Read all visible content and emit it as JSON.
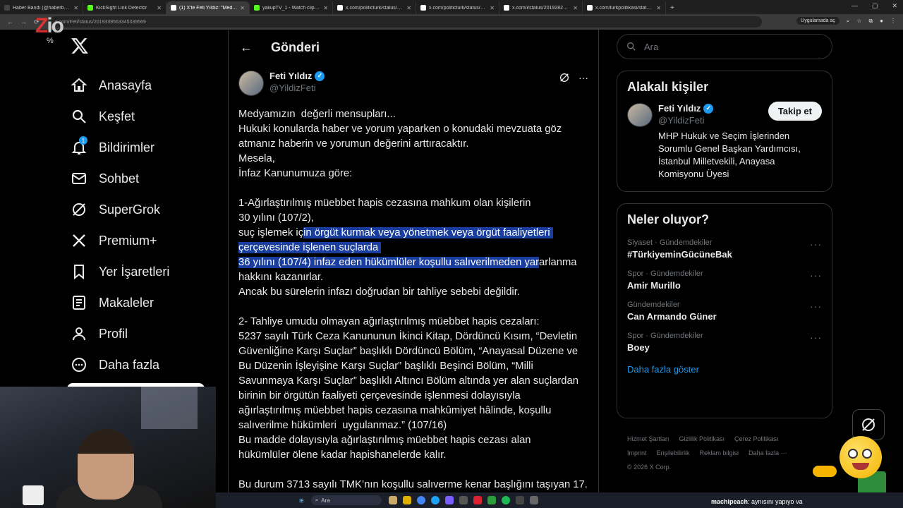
{
  "browser": {
    "tabs": [
      {
        "title": "Haber Bandı (@haberbandicom)",
        "color": "#444",
        "active": false
      },
      {
        "title": "KickSight Link Detector",
        "color": "#53fc18",
        "active": false
      },
      {
        "title": "(1) X'te Feti Yıldız: \"Medyamızın...",
        "color": "#fff",
        "active": true
      },
      {
        "title": "yakupTV_1 - Watch clips on Ki...",
        "color": "#53fc18",
        "active": false
      },
      {
        "title": "x.com/politicturk/status/20193...",
        "color": "#fff",
        "active": false
      },
      {
        "title": "x.com/politicturk/status/20193...",
        "color": "#fff",
        "active": false
      },
      {
        "title": "x.com/i/status/2019282412522...",
        "color": "#fff",
        "active": false
      },
      {
        "title": "x.com/turkpolitikasi/status/124...",
        "color": "#fff",
        "active": false
      }
    ],
    "url": "x.com/Feti/status/2019339563345339569",
    "app_badge": "Uygulamada aç"
  },
  "watermark": {
    "logo": "ZIO",
    "sub": "%"
  },
  "nav": {
    "items": [
      {
        "label": "Anasayfa",
        "icon": "home-icon"
      },
      {
        "label": "Keşfet",
        "icon": "search-icon"
      },
      {
        "label": "Bildirimler",
        "icon": "bell-icon",
        "badge": "1"
      },
      {
        "label": "Sohbet",
        "icon": "mail-icon"
      },
      {
        "label": "SuperGrok",
        "icon": "grok-icon"
      },
      {
        "label": "Premium+",
        "icon": "x-icon"
      },
      {
        "label": "Yer İşaretleri",
        "icon": "bookmark-icon"
      },
      {
        "label": "Makaleler",
        "icon": "article-icon"
      },
      {
        "label": "Profil",
        "icon": "person-icon"
      },
      {
        "label": "Daha fazla",
        "icon": "more-icon"
      }
    ]
  },
  "main": {
    "header_title": "Gönderi",
    "author": {
      "name": "Feti Yıldız",
      "handle": "@YildizFeti"
    },
    "tweet_lines": [
      {
        "segments": [
          {
            "t": "Medyamızın  değerli mensupları...",
            "h": false
          }
        ]
      },
      {
        "segments": [
          {
            "t": "Hukuki konularda haber ve yorum yaparken o konudaki mevzuata göz",
            "h": false
          }
        ]
      },
      {
        "segments": [
          {
            "t": "atmanız haberin ve yorumun değerini arttıracaktır.",
            "h": false
          }
        ]
      },
      {
        "segments": [
          {
            "t": "Mesela,",
            "h": false
          }
        ]
      },
      {
        "segments": [
          {
            "t": "İnfaz Kanunumuza göre:",
            "h": false
          }
        ]
      },
      {
        "segments": [
          {
            "t": "",
            "h": false
          }
        ]
      },
      {
        "segments": [
          {
            "t": "1-Ağırlaştırılmış müebbet hapis cezasına mahkum olan kişilerin",
            "h": false
          }
        ]
      },
      {
        "segments": [
          {
            "t": "30 yılını (107/2),",
            "h": false
          }
        ]
      },
      {
        "segments": [
          {
            "t": "suç işlemek iç",
            "h": false
          },
          {
            "t": "in örgüt kurmak veya yönetmek veya örgüt faaliyetleri ",
            "h": true
          }
        ]
      },
      {
        "segments": [
          {
            "t": "çerçevesinde işlenen suçlarda ",
            "h": true
          }
        ]
      },
      {
        "segments": [
          {
            "t": "36 yılını (107/4) infaz eden hükümlüler koşullu salıverilmeden yar",
            "h": true
          },
          {
            "t": "arlanma",
            "h": false
          }
        ]
      },
      {
        "segments": [
          {
            "t": "hakkını kazanırlar.",
            "h": false
          }
        ]
      },
      {
        "segments": [
          {
            "t": "Ancak bu sürelerin infazı doğrudan bir tahliye sebebi değildir.",
            "h": false
          }
        ]
      },
      {
        "segments": [
          {
            "t": "",
            "h": false
          }
        ]
      },
      {
        "segments": [
          {
            "t": "2- Tahliye umudu olmayan ağırlaştırılmış müebbet hapis cezaları:",
            "h": false
          }
        ]
      },
      {
        "segments": [
          {
            "t": "5237 sayılı Türk Ceza Kanununun İkinci Kitap, Dördüncü Kısım, “Devletin",
            "h": false
          }
        ]
      },
      {
        "segments": [
          {
            "t": "Güvenliğine Karşı Suçlar” başlıklı Dördüncü Bölüm, “Anayasal Düzene ve",
            "h": false
          }
        ]
      },
      {
        "segments": [
          {
            "t": "Bu Düzenin İşleyişine Karşı Suçlar” başlıklı Beşinci Bölüm, “Milli",
            "h": false
          }
        ]
      },
      {
        "segments": [
          {
            "t": "Savunmaya Karşı Suçlar” başlıklı Altıncı Bölüm altında yer alan suçlardan",
            "h": false
          }
        ]
      },
      {
        "segments": [
          {
            "t": "birinin bir örgütün faaliyeti çerçevesinde işlenmesi dolayısıyla",
            "h": false
          }
        ]
      },
      {
        "segments": [
          {
            "t": "ağırlaştırılmış müebbet hapis cezasına mahkûmiyet hâlinde, koşullu",
            "h": false
          }
        ]
      },
      {
        "segments": [
          {
            "t": "salıverilme hükümleri  uygulanmaz.” (107/16)",
            "h": false
          }
        ]
      },
      {
        "segments": [
          {
            "t": "Bu madde dolayısıyla ağırlaştırılmış müebbet hapis cezası alan",
            "h": false
          }
        ]
      },
      {
        "segments": [
          {
            "t": "hükümlüler ölene kadar hapishanelerde kalır.",
            "h": false
          }
        ]
      },
      {
        "segments": [
          {
            "t": "",
            "h": false
          }
        ]
      },
      {
        "segments": [
          {
            "t": "Bu durum 3713 sayılı TMK’nın koşullu salıverme kenar başlığını taşıyan 17.",
            "h": false
          }
        ]
      }
    ]
  },
  "sidebar": {
    "search_placeholder": "Ara",
    "related": {
      "title": "Alakalı kişiler",
      "name": "Feti Yıldız",
      "handle": "@YildizFeti",
      "follow_label": "Takip et",
      "bio": "MHP Hukuk ve Seçim İşlerinden Sorumlu Genel Başkan Yardımcısı, İstanbul Milletvekili, Anayasa Komisyonu Üyesi"
    },
    "trends": {
      "title": "Neler oluyor?",
      "items": [
        {
          "meta": "Siyaset · Gündemdekiler",
          "name": "#TürkiyeminGücüneBak"
        },
        {
          "meta": "Spor · Gündemdekiler",
          "name": "Amir Murillo"
        },
        {
          "meta": "Gündemdekiler",
          "name": "Can Armando Güner"
        },
        {
          "meta": "Spor · Gündemdekiler",
          "name": "Boey"
        }
      ],
      "show_more": "Daha fazla göster"
    },
    "footer": {
      "row1": [
        "Hizmet Şartları",
        "Gizlilik Politikası",
        "Çerez Politikası"
      ],
      "row2": [
        "Imprint",
        "Erişilebilirlik",
        "Reklam bilgisi",
        "Daha fazla ···"
      ],
      "copyright": "© 2026 X Corp."
    }
  },
  "taskbar": {
    "search_placeholder": "Ara"
  },
  "chat": {
    "user": "machipeach",
    "message": ": aynısını yapıyo va"
  }
}
